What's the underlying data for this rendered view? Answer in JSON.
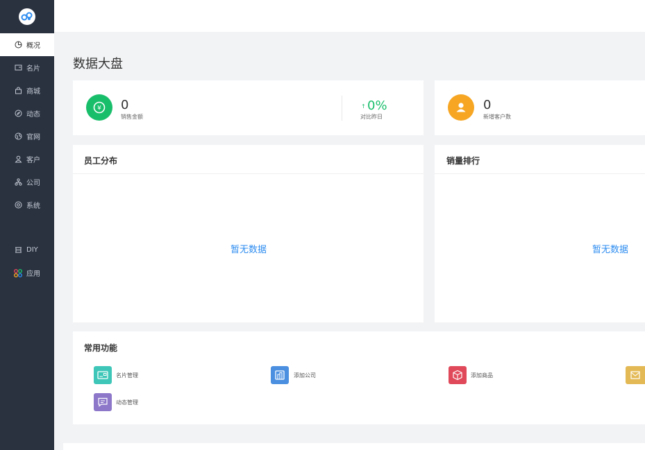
{
  "sidebar": {
    "items": [
      {
        "label": "概况",
        "icon": "pie-chart-icon"
      },
      {
        "label": "名片",
        "icon": "card-icon"
      },
      {
        "label": "商城",
        "icon": "shop-icon"
      },
      {
        "label": "动态",
        "icon": "compass-icon"
      },
      {
        "label": "官网",
        "icon": "globe-icon"
      },
      {
        "label": "客户",
        "icon": "user-icon"
      },
      {
        "label": "公司",
        "icon": "org-icon"
      },
      {
        "label": "系统",
        "icon": "gear-icon"
      },
      {
        "label": "DIY",
        "icon": "diy-icon"
      },
      {
        "label": "应用",
        "icon": "apps-icon"
      }
    ]
  },
  "main": {
    "title": "数据大盘",
    "stats": {
      "sales": {
        "value": "0",
        "label": "销售金额",
        "change": "0%",
        "change_label": "对比昨日",
        "arrow": "↑"
      },
      "customers": {
        "value": "0",
        "label": "新增客户数"
      }
    },
    "staff": {
      "title": "员工分布",
      "empty": "暂无数据"
    },
    "ranking": {
      "title": "销量排行",
      "empty": "暂无数据"
    },
    "functions": {
      "title": "常用功能",
      "items": [
        {
          "label": "名片管理"
        },
        {
          "label": "添加公司"
        },
        {
          "label": "添加商品"
        },
        {
          "label": "动态管理"
        }
      ]
    }
  },
  "colors": {
    "sidebar_bg": "#2a3240",
    "green": "#19be6b",
    "orange": "#f6a623",
    "blue_text": "#2d8cf0",
    "teal": "#3ec6b8",
    "blue": "#4a8fe0",
    "red": "#e0495a",
    "yellow": "#e3b955",
    "purple": "#8c77c9"
  }
}
